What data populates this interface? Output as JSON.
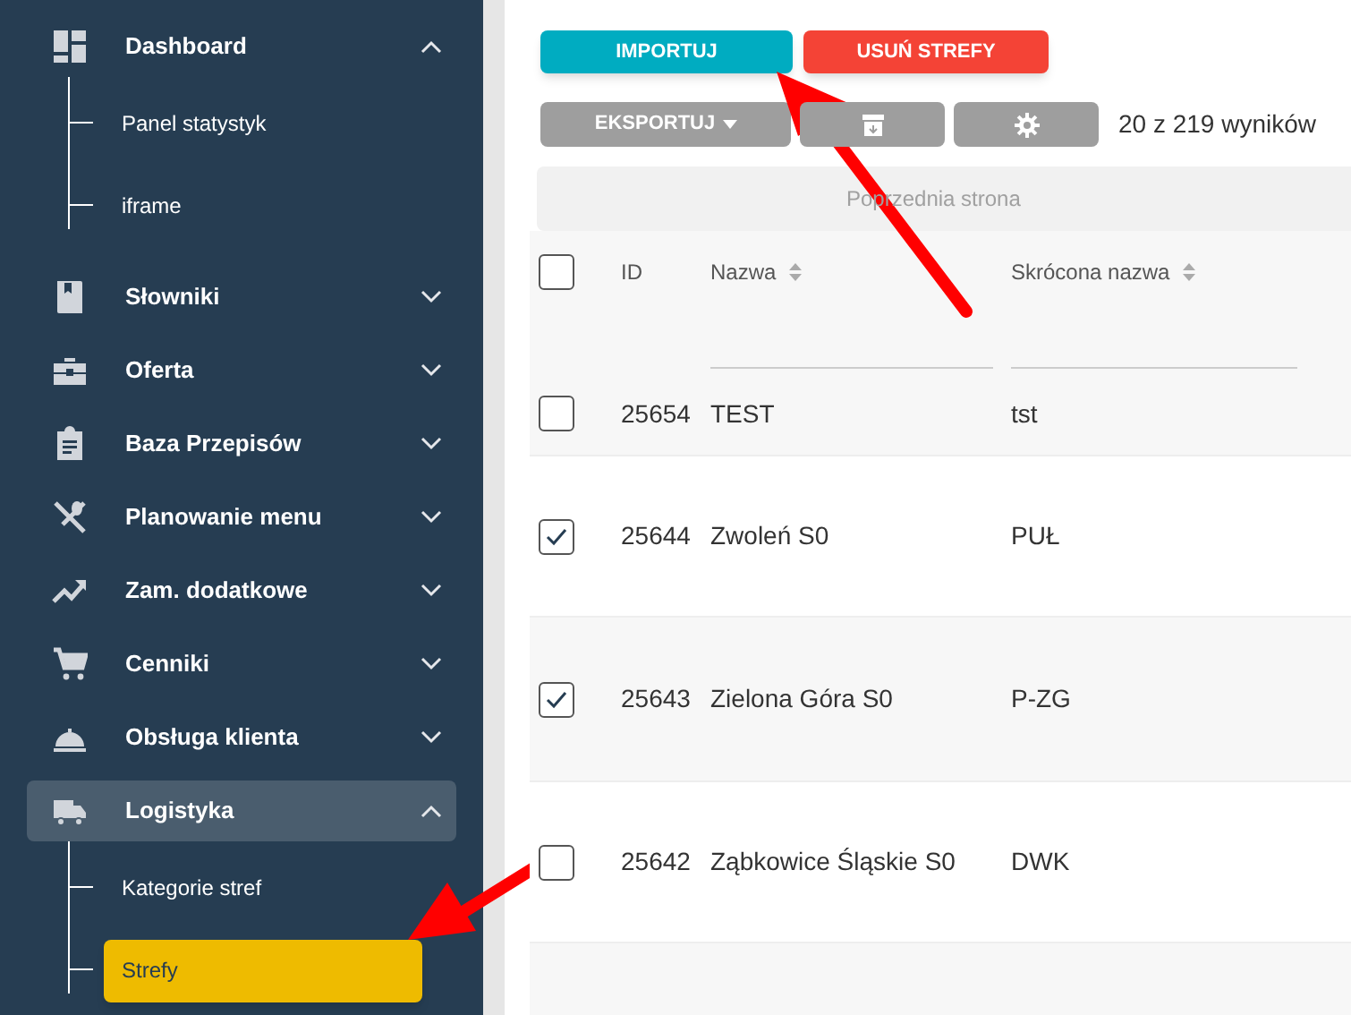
{
  "sidebar": {
    "items": [
      {
        "label": "Dashboard",
        "expanded": true,
        "selected": false,
        "children": [
          {
            "label": "Panel statystyk",
            "selected": false
          },
          {
            "label": "iframe",
            "selected": false
          }
        ]
      },
      {
        "label": "Słowniki",
        "expanded": false,
        "selected": false
      },
      {
        "label": "Oferta",
        "expanded": false,
        "selected": false
      },
      {
        "label": "Baza Przepisów",
        "expanded": false,
        "selected": false
      },
      {
        "label": "Planowanie menu",
        "expanded": false,
        "selected": false
      },
      {
        "label": "Zam. dodatkowe",
        "expanded": false,
        "selected": false
      },
      {
        "label": "Cenniki",
        "expanded": false,
        "selected": false
      },
      {
        "label": "Obsługa klienta",
        "expanded": false,
        "selected": false
      },
      {
        "label": "Logistyka",
        "expanded": true,
        "selected": true,
        "children": [
          {
            "label": "Kategorie stref",
            "selected": false
          },
          {
            "label": "Strefy",
            "selected": true
          }
        ]
      }
    ]
  },
  "actions": {
    "import": "IMPORTUJ",
    "delete": "USUŃ STREFY",
    "export": "EKSPORTUJ",
    "result_count": "20 z 219 wyników"
  },
  "pagination": {
    "previous": "Poprzednia strona"
  },
  "table": {
    "select_all": false,
    "columns": [
      {
        "label": "ID",
        "sortable": false
      },
      {
        "label": "Nazwa",
        "sortable": true
      },
      {
        "label": "Skrócona nazwa",
        "sortable": true
      }
    ],
    "rows": [
      {
        "checked": false,
        "id": "25654",
        "name": "TEST",
        "short": "tst"
      },
      {
        "checked": true,
        "id": "25644",
        "name": "Zwoleń S0",
        "short": "PUŁ"
      },
      {
        "checked": true,
        "id": "25643",
        "name": "Zielona Góra S0",
        "short": "P-ZG"
      },
      {
        "checked": false,
        "id": "25642",
        "name": "Ząbkowice Śląskie S0",
        "short": "DWK"
      }
    ]
  }
}
